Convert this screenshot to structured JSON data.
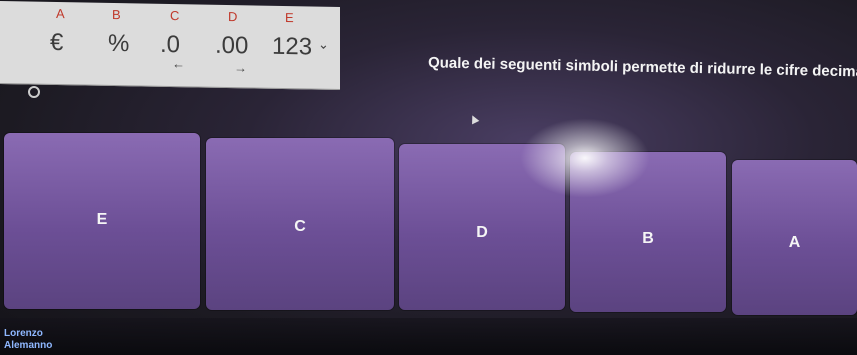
{
  "toolbar": {
    "letters": [
      "A",
      "B",
      "C",
      "D",
      "E"
    ],
    "symbols": [
      "€",
      "%",
      ".0",
      ".00",
      "123"
    ],
    "dropdown": "⌄",
    "arrow_left": "←",
    "arrow_right": "→"
  },
  "question": "Quale dei seguenti simboli permette di ridurre le cifre decimali:",
  "answers": [
    "E",
    "C",
    "D",
    "B",
    "A"
  ],
  "player": {
    "first": "Lorenzo",
    "last": "Alemanno"
  },
  "colors": {
    "tile": "#7a5ca6",
    "question_text": "#f4f4f4",
    "letter": "#c0392b"
  }
}
